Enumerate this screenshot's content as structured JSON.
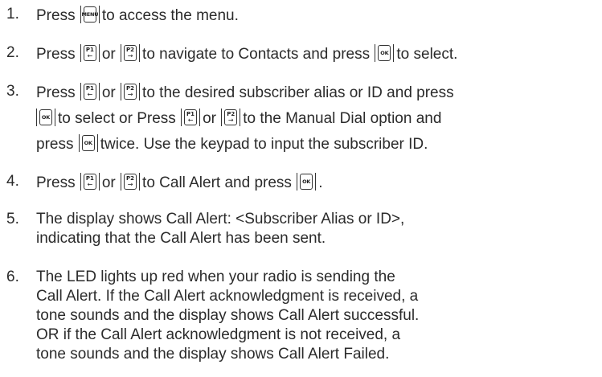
{
  "keys": {
    "menu": "MENU",
    "ok": "OK",
    "p1": "P1",
    "p2": "P2",
    "left_arrow": "←",
    "right_arrow": "→"
  },
  "steps": [
    {
      "num": "1.",
      "lines": [
        [
          "Press ",
          "to access the menu."
        ]
      ]
    },
    {
      "num": "2.",
      "lines": [
        [
          "Press ",
          "or ",
          "to navigate to Contacts and press ",
          "to select."
        ]
      ]
    },
    {
      "num": "3.",
      "lines": [
        [
          "Press ",
          "or ",
          "to the desired subscriber alias or ID and press"
        ],
        [
          "to select or Press ",
          "or ",
          "to the Manual Dial option and"
        ],
        [
          "press ",
          "twice. Use the keypad to input the subscriber ID."
        ]
      ]
    },
    {
      "num": "4.",
      "lines": [
        [
          "Press ",
          "or ",
          "to Call Alert and press ",
          "."
        ]
      ]
    },
    {
      "num": "5.",
      "lines": [
        "The display shows Call Alert: <Subscriber Alias or ID>,",
        "indicating that the Call Alert has been sent."
      ]
    },
    {
      "num": "6.",
      "lines": [
        "The LED lights up red when your radio is sending the",
        "Call Alert. If the Call Alert acknowledgment is received, a",
        "tone sounds and the display shows Call Alert successful.",
        "OR if the Call Alert acknowledgment is not received, a",
        "tone sounds and the display shows Call Alert Failed."
      ]
    }
  ]
}
